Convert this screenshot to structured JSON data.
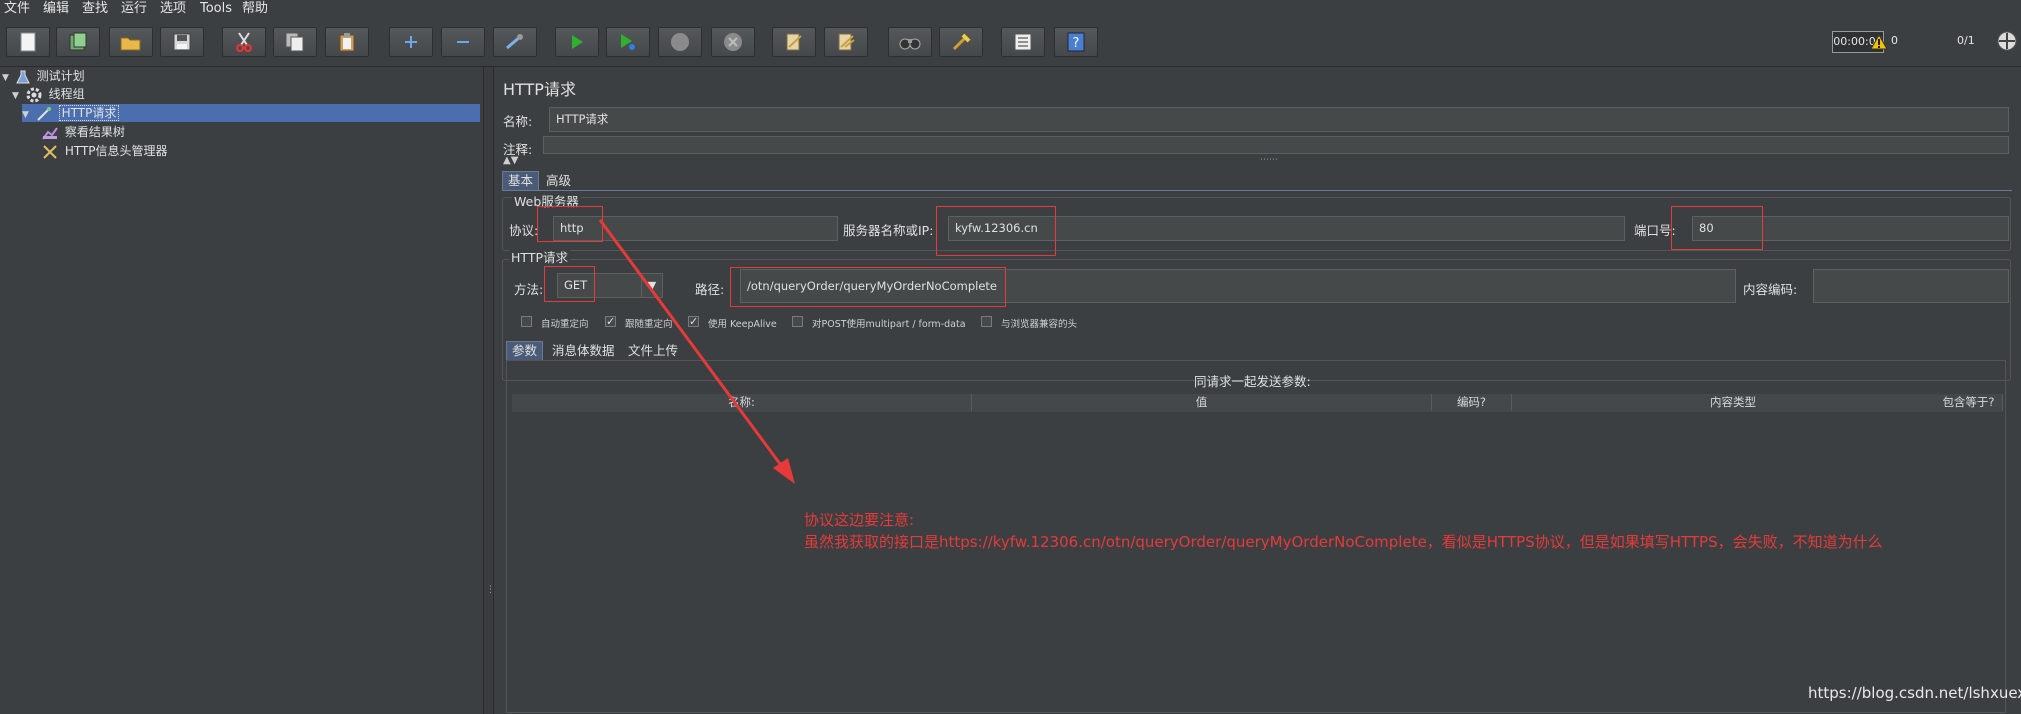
{
  "menu": [
    "文件",
    "编辑",
    "查找",
    "运行",
    "选项",
    "Tools",
    "帮助"
  ],
  "toolbar": {
    "buttons": [
      "new",
      "templates",
      "open",
      "save",
      "cut",
      "copy",
      "paste",
      "expand",
      "collapse",
      "toggle",
      "start",
      "start-no-pause",
      "stop",
      "shutdown",
      "clear",
      "clear-all",
      "search",
      "reset-search",
      "function-helper",
      "help"
    ],
    "timer": "00:00:05",
    "warnings": "0",
    "threads": "0/1"
  },
  "tree": [
    {
      "label": "测试计划",
      "icon": "flask-icon"
    },
    {
      "label": "线程组",
      "icon": "gear-icon"
    },
    {
      "label": "HTTP请求",
      "icon": "pipette-icon"
    },
    {
      "label": "察看结果树",
      "icon": "chart-icon"
    },
    {
      "label": "HTTP信息头管理器",
      "icon": "tools-icon"
    }
  ],
  "sampler": {
    "title": "HTTP请求",
    "name_label": "名称:",
    "name_value": "HTTP请求",
    "comment_label": "注释:",
    "tabs": [
      "基本",
      "高级"
    ],
    "web_server_group": "Web服务器",
    "protocol_label": "协议:",
    "protocol_value": "http",
    "server_label": "服务器名称或IP:",
    "server_value": "kyfw.12306.cn",
    "port_label": "端口号:",
    "port_value": "80",
    "http_group": "HTTP请求",
    "method_label": "方法:",
    "method_value": "GET",
    "path_label": "路径:",
    "path_value": "/otn/queryOrder/queryMyOrderNoComplete",
    "encoding_label": "内容编码:",
    "options": [
      {
        "label": "自动重定向",
        "checked": false
      },
      {
        "label": "跟随重定向",
        "checked": true
      },
      {
        "label": "使用 KeepAlive",
        "checked": true
      },
      {
        "label": "对POST使用multipart / form-data",
        "checked": false
      },
      {
        "label": "与浏览器兼容的头",
        "checked": false
      }
    ],
    "param_tabs": [
      "参数",
      "消息体数据",
      "文件上传"
    ],
    "params_caption": "同请求一起发送参数:",
    "columns": [
      "名称:",
      "值",
      "编码?",
      "内容类型",
      "包含等于?"
    ]
  },
  "annotation": {
    "line1": "协议这边要注意:",
    "line2": "虽然我获取的接口是https://kyfw.12306.cn/otn/queryOrder/queryMyOrderNoComplete，看似是HTTPS协议，但是如果填写HTTPS，会失败，不知道为什么",
    "color": "#e63a3a"
  },
  "watermark": "https://blog.csdn.net/lshxuexi"
}
